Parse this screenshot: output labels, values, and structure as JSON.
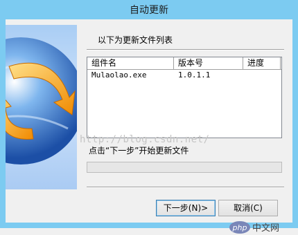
{
  "window": {
    "title": "自动更新"
  },
  "header": {
    "label": "以下为更新文件列表"
  },
  "table": {
    "columns": [
      "组件名",
      "版本号",
      "进度"
    ],
    "rows": [
      {
        "name": "Mulaolao.exe",
        "version": "1.0.1.1",
        "progress": ""
      }
    ]
  },
  "watermark": "http://blog.csdn.net/",
  "hint": "点击“下一步”开始更新文件",
  "progress": {
    "value": 0
  },
  "buttons": {
    "next": "下一步(N)>",
    "cancel": "取消(C)"
  },
  "logo": {
    "text": "php中文网"
  },
  "colors": {
    "titlebar": "#7ccbf1",
    "progress_fill": "#06b025"
  }
}
